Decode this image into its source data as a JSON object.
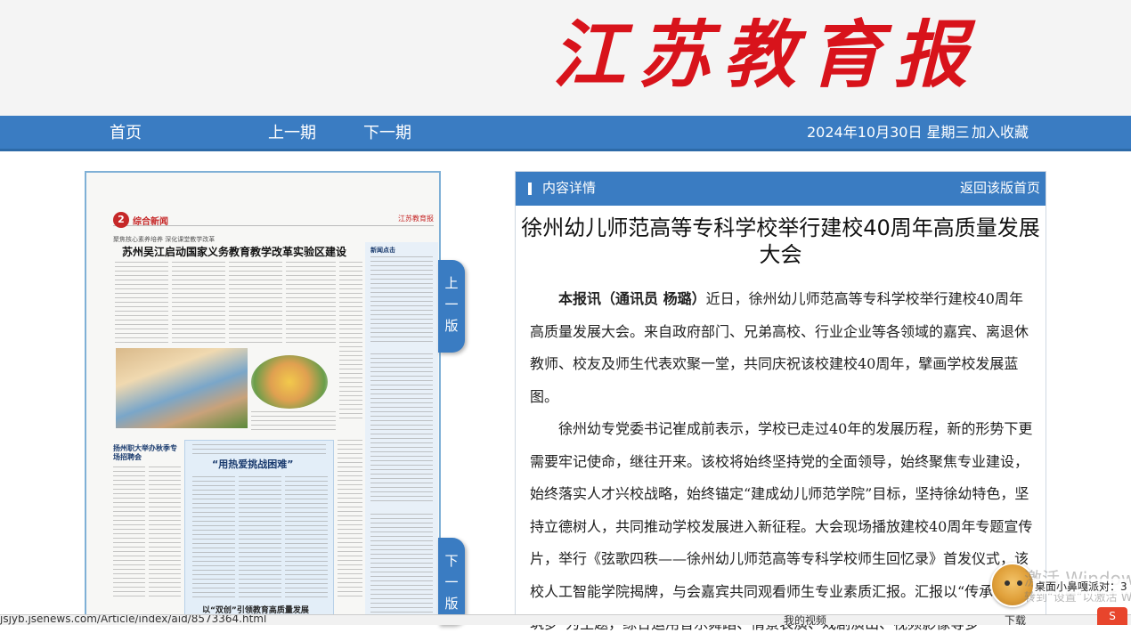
{
  "header": {
    "masthead": "江苏教育报"
  },
  "nav": {
    "home": "首页",
    "prev_issue": "上一期",
    "next_issue": "下一期",
    "date": "2024年10月30日 星期三",
    "favorite": "加入收藏"
  },
  "paper": {
    "page_no": "2",
    "section": "综合新闻",
    "logo": "江苏教育报",
    "kicker": "聚焦核心素养培养 深化课堂教学改革",
    "headline": "苏州吴江启动国家义务教育教学改革实验区建设",
    "left_head": "扬州职大举办秋季专场招聘会",
    "box_headline": "“用热爱挑战困难”",
    "bottom_headline": "以“双创”引领教育高质量发展",
    "side_tag": "新闻点击"
  },
  "tabs": {
    "prev_page": "上一版",
    "next_page": "下一版"
  },
  "article_panel": {
    "label": "内容详情",
    "back": "返回该版首页",
    "title": "徐州幼儿师范高等专科学校举行建校40周年高质量发展大会",
    "lead_byline": "本报讯（通讯员 杨璐）",
    "p1_rest": "近日，徐州幼儿师范高等专科学校举行建校40周年高质量发展大会。来自政府部门、兄弟高校、行业企业等各领域的嘉宾、离退休教师、校友及师生代表欢聚一堂，共同庆祝该校建校40周年，擘画学校发展蓝图。",
    "p2": "徐州幼专党委书记崔成前表示，学校已走过40年的发展历程，新的形势下更需要牢记使命，继往开来。该校将始终坚持党的全面领导，始终聚焦专业建设，始终落实人才兴校战略，始终锚定“建成幼儿师范学院”目标，坚持徐幼特色，坚持立德树人，共同推动学校发展进入新征程。大会现场播放建校40周年专题宣传片，举行《弦歌四秩——徐州幼儿师范高等专科学校师生回忆录》首发仪式，该校人工智能学院揭牌，与会嘉宾共同观看师生专业素质汇报。汇报以“传承·礼赞·筑梦”为主题，综合运用音乐舞蹈、情景表演、戏剧演出、视频影像等多"
  },
  "status": {
    "url": "jsjyb.jsenews.com/Article/index/aid/8573364.html",
    "video": "我的视频",
    "download": "下载"
  },
  "overlay": {
    "watermark": "激活 Windows",
    "watermark_sub": "转到“设置”以激活 Windows。",
    "pet_tip": "桌面小鼻嘎派对：3"
  }
}
